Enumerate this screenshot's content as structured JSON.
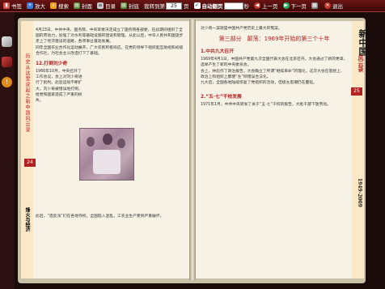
{
  "toolbar": {
    "bookmark": "书签",
    "zoom_in": "放大",
    "search": "搜索",
    "cover": "封面",
    "toc": "目录",
    "back_cover": "封底",
    "goto_label": "我转到第",
    "goto_page": "25",
    "page_unit": "页",
    "auto_flip": "自动翻页",
    "seconds": "秒",
    "prev": "上一页",
    "next": "下一页",
    "close": "退出"
  },
  "book": {
    "left_page_number": "24",
    "right_page_number": "25",
    "left_band_title": "历史从这里说起之新中国风云录",
    "left_band_subtitle": "烽火与经济",
    "right_side_title": "新中国",
    "right_side_subtitle": "风云录",
    "right_side_years": "1949-2009",
    "left_paragraph_1": "4月23日，中共中央、国务院、中央军委决定成立了国务院各部委，在此期间组织了全国的劳动力，加强了对水利等基础设施的建设和管理。从此以后，中华人民共和国逐步走上了经济建设的道路，各项事业蓬勃发展。",
    "left_paragraph_2": "同年全国农业合作化运动展开，广大农民积极响应，在党的领导下组织起互助组和初级合作社，为社会主义改造打下了基础。",
    "left_heading": "12.打倒刘少奇",
    "left_paragraph_3": "1966年10月，中央召开了工作会议，会上对刘少奇进行了批判。此后运动不断扩大，刘少奇被错误地打倒，给党和国家造成了严重的损失。",
    "left_paragraph_4": "此后，“造反派”们在各地夺权，全国陷入混乱，工农业生产受到严重破坏。",
    "right_top_line": "对少奇一案就是中国共产党历史上最大的冤案。",
    "chapter_title": "第三部分　颠荡：1969年开始的第三个十年",
    "right_heading_1": "1.中共九大召开",
    "right_paragraph_1": "1969年4月1日，中国共产党第九次全国代表大会在北京召开。大会通过了新的党章，选举产生了新的中央委员会。",
    "right_paragraph_2": "会上，林彪作了政治报告，大会确立了所谓“继续革命”的理论，这次大会在思想上、政治上和组织上都使“左”倾错误合法化。",
    "right_paragraph_3": "九大后，全国各地陆续恢复了党组织的活动，但极左思潮仍在蔓延。",
    "right_heading_2": "2.“五·七”干校发展",
    "right_paragraph_4": "1971年1月，中共中央转发了关于“五·七”干校的报告，大批干部下放劳动。"
  }
}
